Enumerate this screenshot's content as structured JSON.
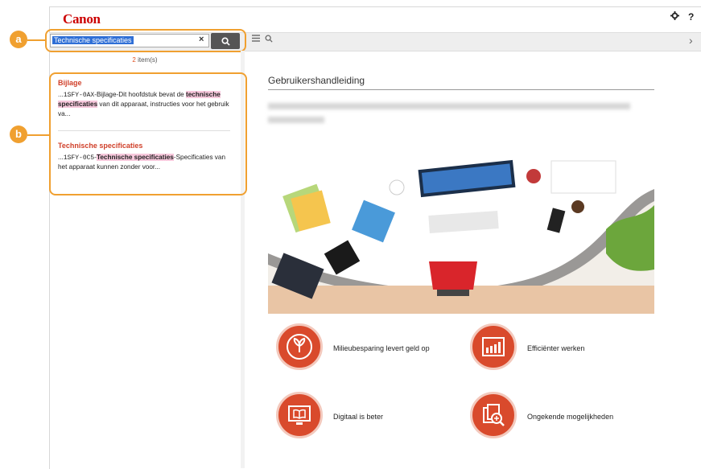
{
  "brand": {
    "name": "Canon",
    "color": "#cc0000"
  },
  "header": {
    "settings_icon": "gear-icon",
    "help_label": "?"
  },
  "toolbar": {
    "search_value": "Technische specificaties",
    "clear_label": "×",
    "menu_icon": "hamburger-icon",
    "search_icon": "search-icon",
    "next_label": "›"
  },
  "callouts": {
    "a": "a",
    "b": "b"
  },
  "results": {
    "count_number": "2",
    "count_suffix": "item(s)",
    "items": [
      {
        "title": "Bijlage",
        "prefix": "...",
        "code": "1SFY-0AX",
        "text1": "-Bijlage-Dit hoofdstuk bevat de ",
        "keyword": "technische specificaties",
        "text2": " van dit apparaat, instructies voor het gebruik va..."
      },
      {
        "title": "Technische specificaties",
        "prefix": "...",
        "code": "1SFY-0C5",
        "text1": "-",
        "keyword": "Technische specificaties",
        "text2": "-Specificaties van het apparaat kunnen zonder voor..."
      }
    ]
  },
  "content": {
    "title": "Gebruikershandleiding",
    "features": [
      {
        "label": "Milieubesparing levert geld op",
        "icon": "leaf-icon"
      },
      {
        "label": "Efficiënter werken",
        "icon": "bar-chart-icon"
      },
      {
        "label": "Digitaal is beter",
        "icon": "monitor-book-icon"
      },
      {
        "label": "Ongekende mogelijkheden",
        "icon": "documents-search-icon"
      }
    ]
  },
  "colors": {
    "accent": "#f0a030",
    "feature": "#d94a2c",
    "highlight": "#f7c8dc"
  }
}
